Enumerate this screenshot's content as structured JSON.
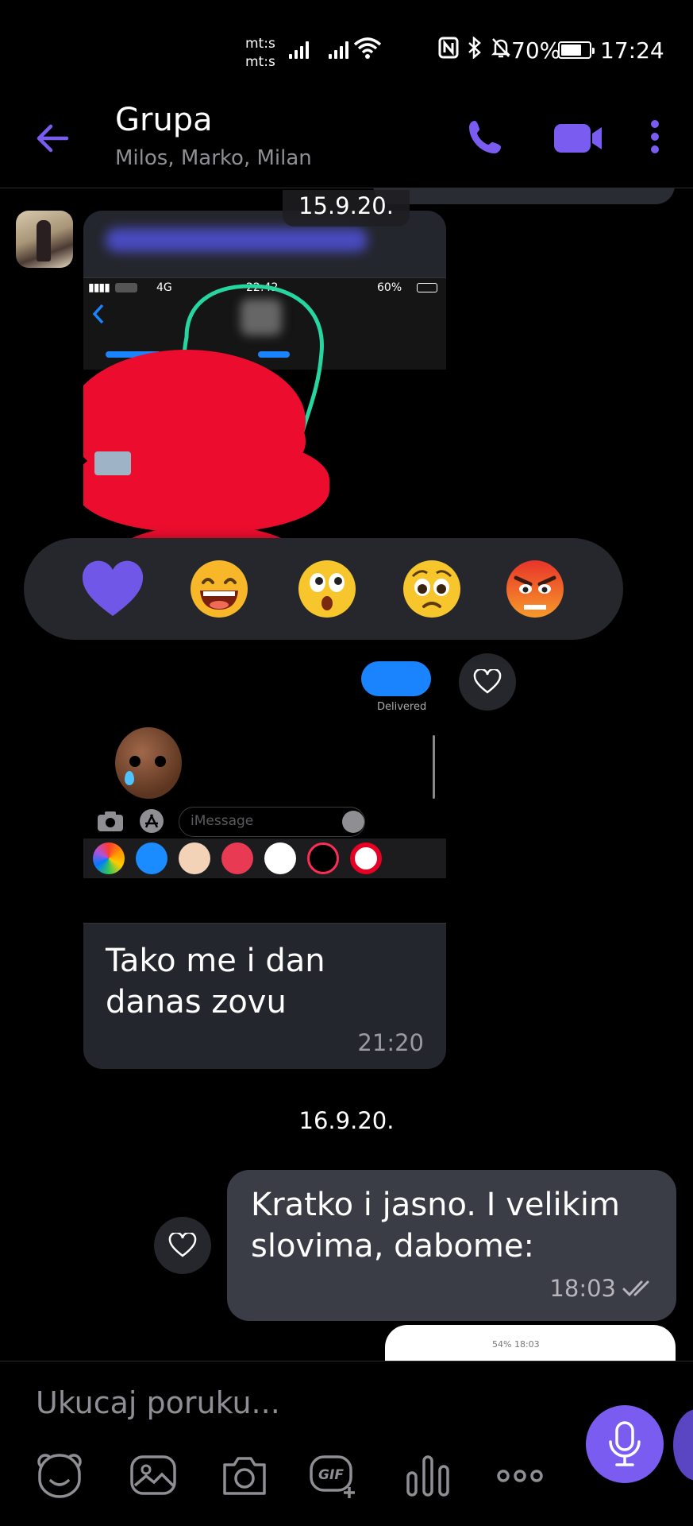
{
  "status_bar": {
    "carrier_1": "mt:s",
    "carrier_2": "mt:s",
    "battery_pct": "70%",
    "time": "17:24"
  },
  "header": {
    "title": "Grupa",
    "subtitle": "Milos, Marko, Milan"
  },
  "chat": {
    "date_1": "15.9.20.",
    "message_1": {
      "screenshot": {
        "status_network": "4G",
        "status_time": "22:42",
        "status_battery": "60%",
        "delivered_label": "Delivered",
        "input_placeholder": "iMessage"
      },
      "text": "Tako me i dan danas zovu",
      "time": "21:20"
    },
    "reactions": [
      "heart",
      "laughing",
      "surprised",
      "sad",
      "angry"
    ],
    "date_2": "16.9.20.",
    "message_2": {
      "text": "Kratko i jasno. I velikim slovima, dabome:",
      "time": "18:03"
    },
    "preview_status": "54% 18:03"
  },
  "composer": {
    "placeholder": "Ukucaj poruku...",
    "tools": [
      "sticker-icon",
      "gallery-icon",
      "camera-icon",
      "gif-icon",
      "poll-icon",
      "more-icon"
    ]
  },
  "colors": {
    "accent": "#7b5cf0",
    "incoming_bubble": "#24262d",
    "outgoing_bubble": "#3a3d45"
  }
}
